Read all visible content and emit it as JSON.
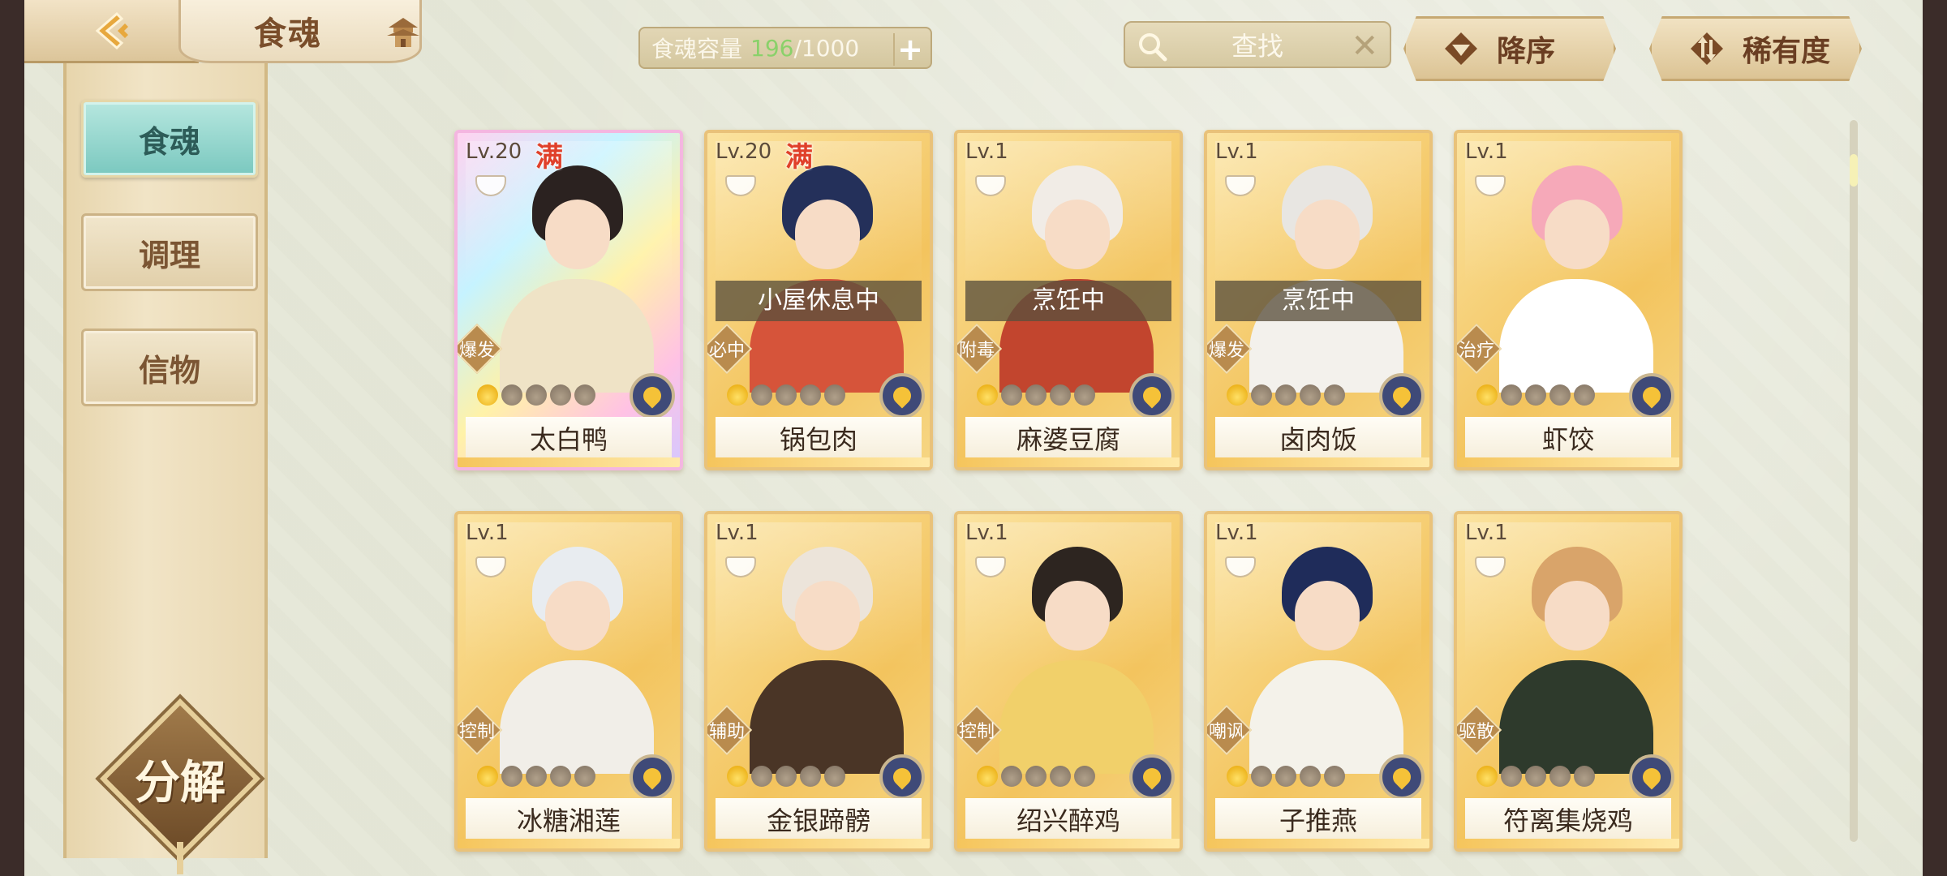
{
  "header": {
    "title": "食魂",
    "capacity": {
      "label": "食魂容量",
      "current": "196",
      "max": "/1000"
    },
    "search_label": "查找",
    "sort_order_label": "降序",
    "sort_rarity_label": "稀有度"
  },
  "sidebar": {
    "tabs": [
      {
        "label": "食魂",
        "active": true
      },
      {
        "label": "调理",
        "active": false
      },
      {
        "label": "信物",
        "active": false
      }
    ],
    "decompose_label": "分解"
  },
  "cards": [
    {
      "level": "Lv.20",
      "full_badge": "满",
      "status": "",
      "role": "爆发",
      "name": "太白鸭",
      "rainbow": true,
      "hair": "#2b2220",
      "body": "#efe3c6",
      "lit_stars": 1
    },
    {
      "level": "Lv.20",
      "full_badge": "满",
      "status": "小屋休息中",
      "role": "必中",
      "name": "锅包肉",
      "rainbow": false,
      "hair": "#24305a",
      "body": "#d6543a",
      "lit_stars": 1
    },
    {
      "level": "Lv.1",
      "full_badge": "",
      "status": "烹饪中",
      "role": "附毒",
      "name": "麻婆豆腐",
      "rainbow": false,
      "hair": "#f1ece6",
      "body": "#c2452e",
      "lit_stars": 1
    },
    {
      "level": "Lv.1",
      "full_badge": "",
      "status": "烹饪中",
      "role": "爆发",
      "name": "卤肉饭",
      "rainbow": false,
      "hair": "#e8e6e2",
      "body": "#f3f1ec",
      "lit_stars": 1
    },
    {
      "level": "Lv.1",
      "full_badge": "",
      "status": "",
      "role": "治疗",
      "name": "虾饺",
      "rainbow": false,
      "hair": "#f6a9b9",
      "body": "#ffffff",
      "lit_stars": 1
    },
    {
      "level": "Lv.1",
      "full_badge": "",
      "status": "",
      "role": "控制",
      "name": "冰糖湘莲",
      "rainbow": false,
      "hair": "#e8ecf0",
      "body": "#f1eee8",
      "lit_stars": 1
    },
    {
      "level": "Lv.1",
      "full_badge": "",
      "status": "",
      "role": "辅助",
      "name": "金银蹄髈",
      "rainbow": false,
      "hair": "#ece4da",
      "body": "#4a3526",
      "lit_stars": 1
    },
    {
      "level": "Lv.1",
      "full_badge": "",
      "status": "",
      "role": "控制",
      "name": "绍兴醉鸡",
      "rainbow": false,
      "hair": "#2d2520",
      "body": "#f1d06a",
      "lit_stars": 1
    },
    {
      "level": "Lv.1",
      "full_badge": "",
      "status": "",
      "role": "嘲讽",
      "name": "子推燕",
      "rainbow": false,
      "hair": "#1f2c5a",
      "body": "#f4f2ea",
      "lit_stars": 1
    },
    {
      "level": "Lv.1",
      "full_badge": "",
      "status": "",
      "role": "驱散",
      "name": "符离集烧鸡",
      "rainbow": false,
      "hair": "#d9a46a",
      "body": "#2e3a2c",
      "lit_stars": 1
    }
  ]
}
